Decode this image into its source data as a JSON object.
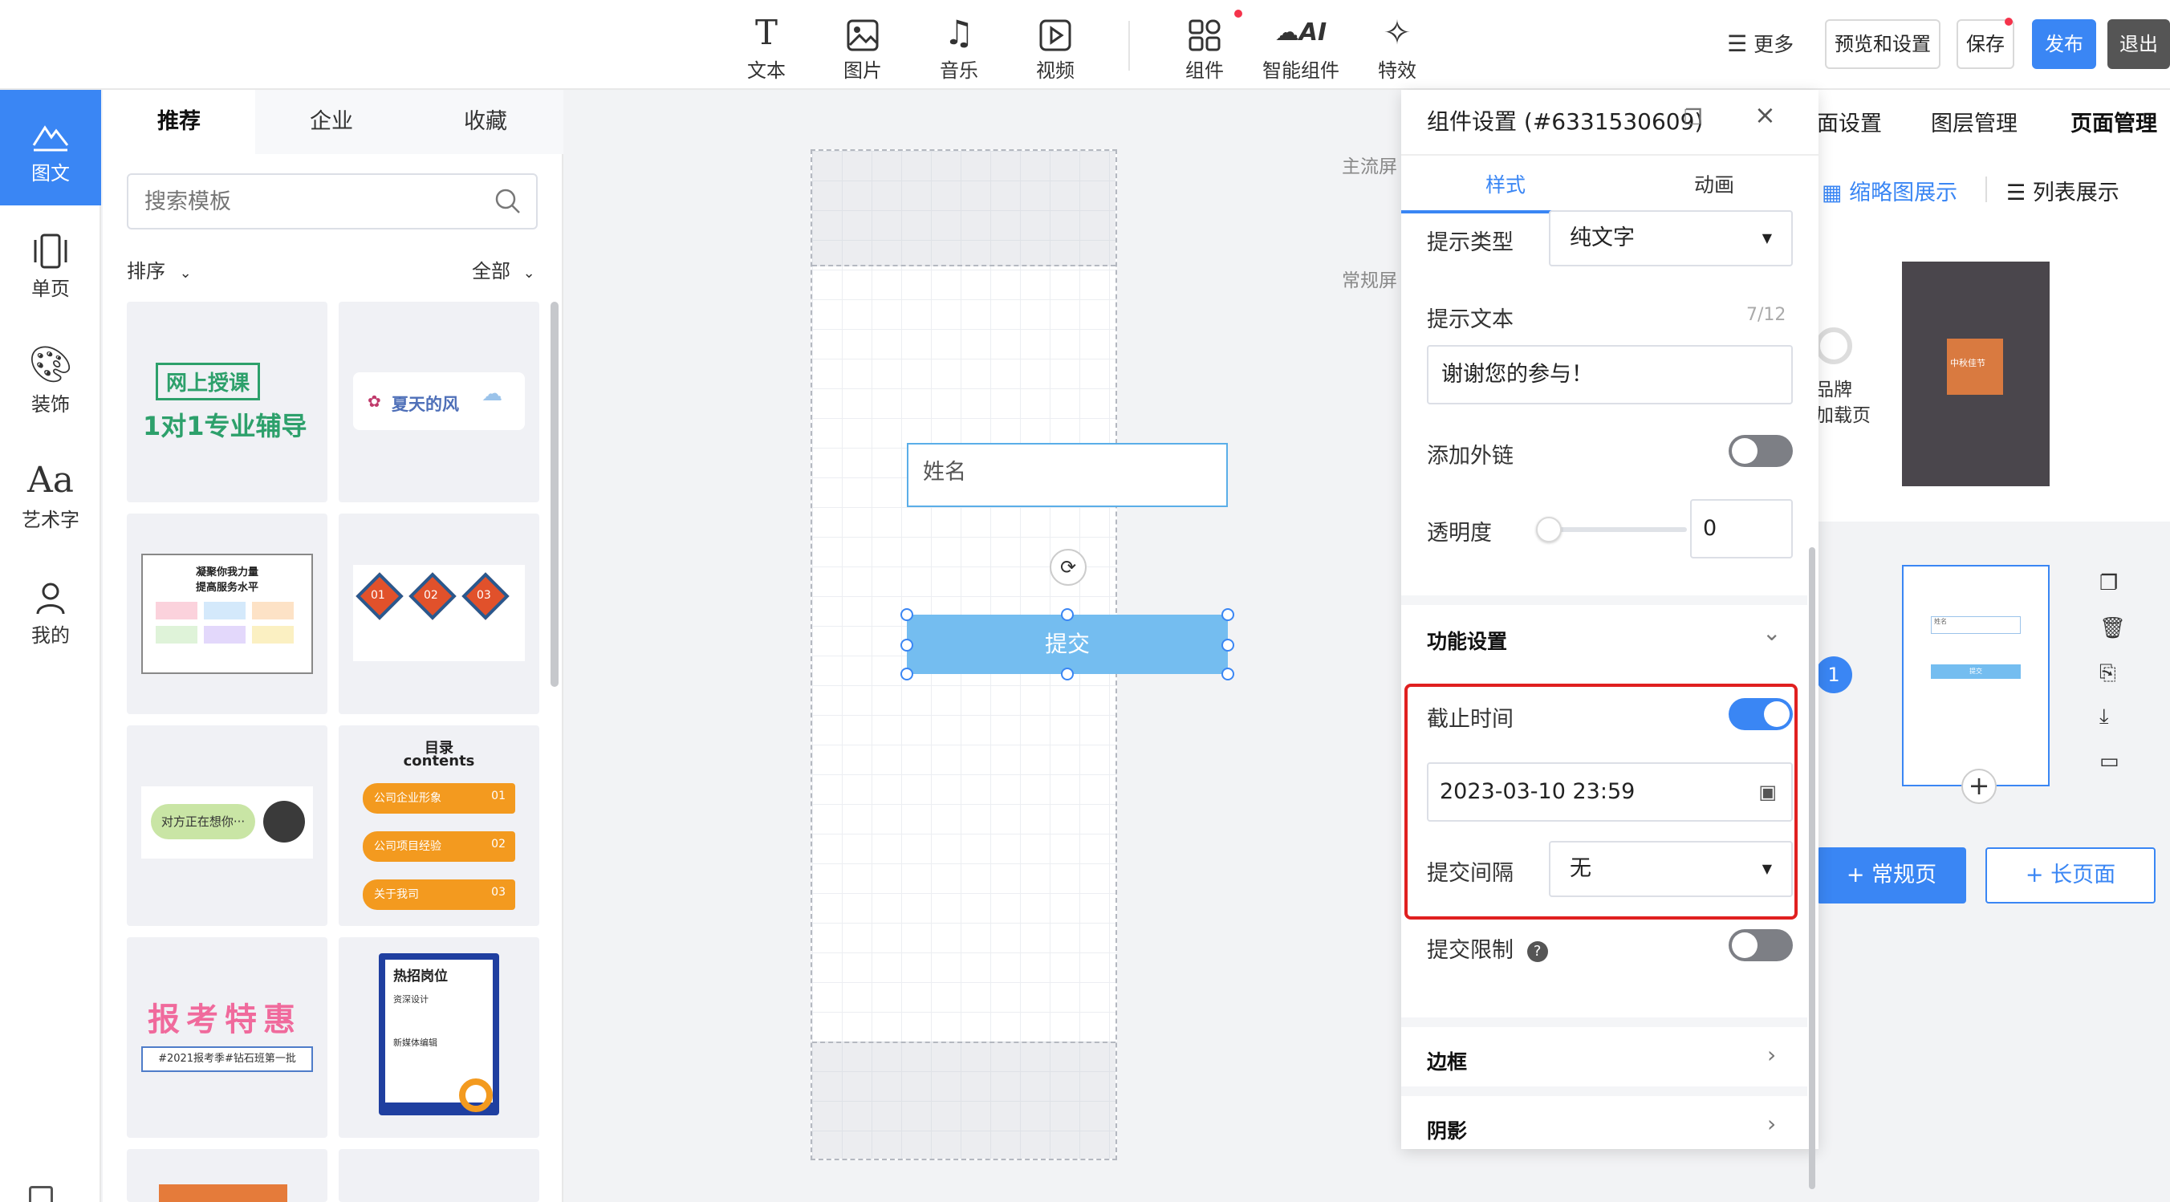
{
  "toolbar": {
    "tools": [
      {
        "label": "文本",
        "icon": "text-icon"
      },
      {
        "label": "图片",
        "icon": "image-icon"
      },
      {
        "label": "音乐",
        "icon": "music-icon"
      },
      {
        "label": "视频",
        "icon": "video-icon"
      },
      {
        "label": "组件",
        "icon": "components-icon"
      },
      {
        "label": "智能组件",
        "icon": "ai-components-icon"
      },
      {
        "label": "特效",
        "icon": "effects-icon"
      }
    ],
    "more_label": "更多",
    "preview_label": "预览和设置",
    "save_label": "保存",
    "publish_label": "发布",
    "exit_label": "退出",
    "accent_color": "#3a86f4"
  },
  "leftnav": {
    "items": [
      {
        "label": "图文",
        "active": true
      },
      {
        "label": "单页"
      },
      {
        "label": "装饰"
      },
      {
        "label": "艺术字"
      },
      {
        "label": "我的"
      }
    ]
  },
  "templates": {
    "tabs": [
      "推荐",
      "企业",
      "收藏"
    ],
    "search_placeholder": "搜索模板",
    "sort_label": "排序",
    "filter_label": "全部",
    "cards": [
      {
        "title": "网上授课",
        "subtitle": "1对1专业辅导"
      },
      {
        "title": "夏天的风"
      },
      {
        "title": "凝聚你我力量",
        "subtitle": "提高服务水平"
      },
      {
        "badges": [
          "01",
          "02",
          "03"
        ]
      },
      {
        "title": "对方正在想你···"
      },
      {
        "title": "目录",
        "subtitle": "contents",
        "items": [
          "公司企业形象",
          "公司项目经验",
          "关于我司"
        ],
        "nums": [
          "01",
          "02",
          "03"
        ]
      },
      {
        "title": "报考特惠",
        "subtitle": "#2021报考季#钻石班第一批"
      },
      {
        "title": "热招岗位",
        "items": [
          "资深设计",
          "新媒体编辑"
        ]
      }
    ]
  },
  "canvas": {
    "label_main_screen": "主流屏",
    "label_normal_screen": "常规屏",
    "name_field_placeholder": "姓名",
    "submit_label": "提交"
  },
  "settings": {
    "title": "组件设置 (#6331530609)",
    "tabs": [
      "样式",
      "动画"
    ],
    "hint_type_label": "提示类型",
    "hint_type_value": "纯文字",
    "hint_text_label": "提示文本",
    "hint_text_count": "7/12",
    "hint_text_value": "谢谢您的参与！",
    "add_link_label": "添加外链",
    "add_link_on": false,
    "opacity_label": "透明度",
    "opacity_value": "0",
    "function_section": "功能设置",
    "deadline_label": "截止时间",
    "deadline_on": true,
    "deadline_value": "2023-03-10 23:59",
    "interval_label": "提交间隔",
    "interval_value": "无",
    "limit_label": "提交限制",
    "limit_on": false,
    "border_section": "边框",
    "shadow_section": "阴影",
    "highlight_color": "#e02020"
  },
  "rightpanel": {
    "tabs": [
      "面设置",
      "图层管理",
      "页面管理"
    ],
    "view_thumb": "缩略图展示",
    "view_list": "列表展示",
    "brand_text_1": "品牌",
    "brand_text_2": "加载页",
    "cover_text": "中秋佳节",
    "page_number": "1",
    "thumb_name": "姓名",
    "thumb_submit": "提交",
    "add_normal_page": "+ 常规页",
    "add_long_page": "+ 长页面"
  }
}
